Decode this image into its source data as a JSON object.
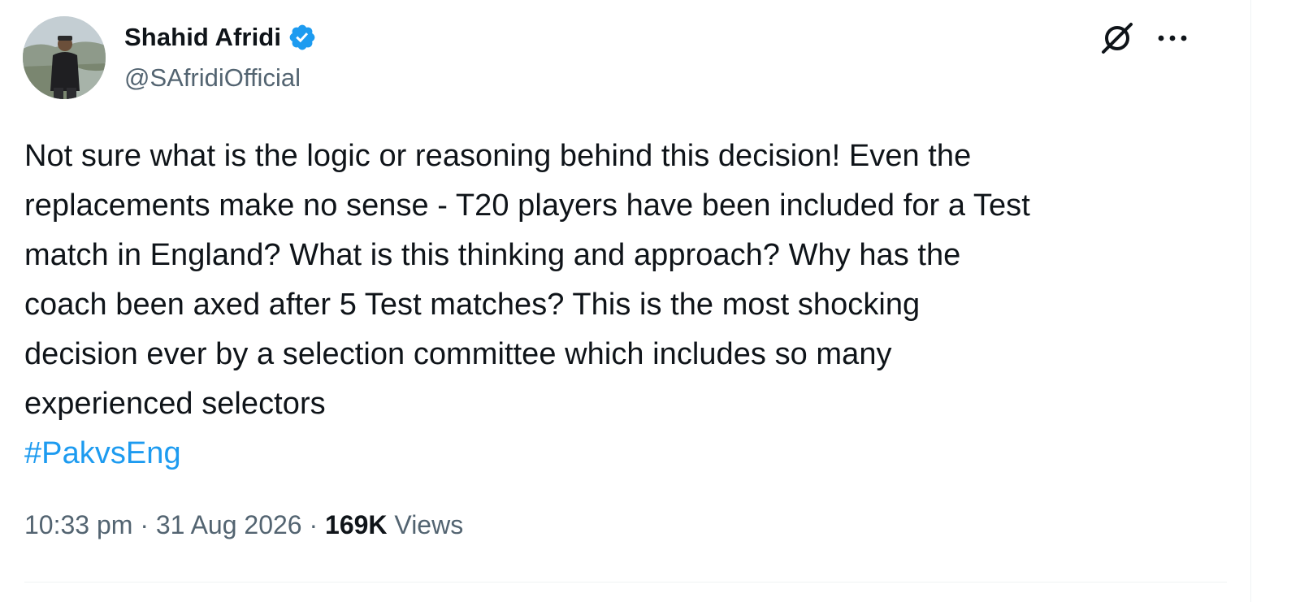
{
  "author": {
    "display_name": "Shahid Afridi",
    "handle": "@SAfridiOfficial",
    "verified": true
  },
  "tweet": {
    "lines": [
      "Not sure what is the logic or reasoning behind this decision! Even the",
      "replacements make no sense - T20 players have been included for a Test",
      "match in England? What is this thinking and approach? Why has the",
      "coach been axed after 5 Test matches? This is the most shocking",
      "decision ever by a selection committee which includes so many",
      "experienced selectors"
    ],
    "hashtag": "#PakvsEng",
    "time": "10:33 pm",
    "separator": "·",
    "date": "31 Aug 2026",
    "views_count": "169K",
    "views_label": "Views"
  },
  "icons": {
    "verified": "verified-badge-icon",
    "grok": "grok-icon",
    "more": "more-options-icon"
  },
  "colors": {
    "text": "#0f1419",
    "secondary": "#536471",
    "link": "#1d9bf0",
    "verified": "#1d9bf0"
  }
}
